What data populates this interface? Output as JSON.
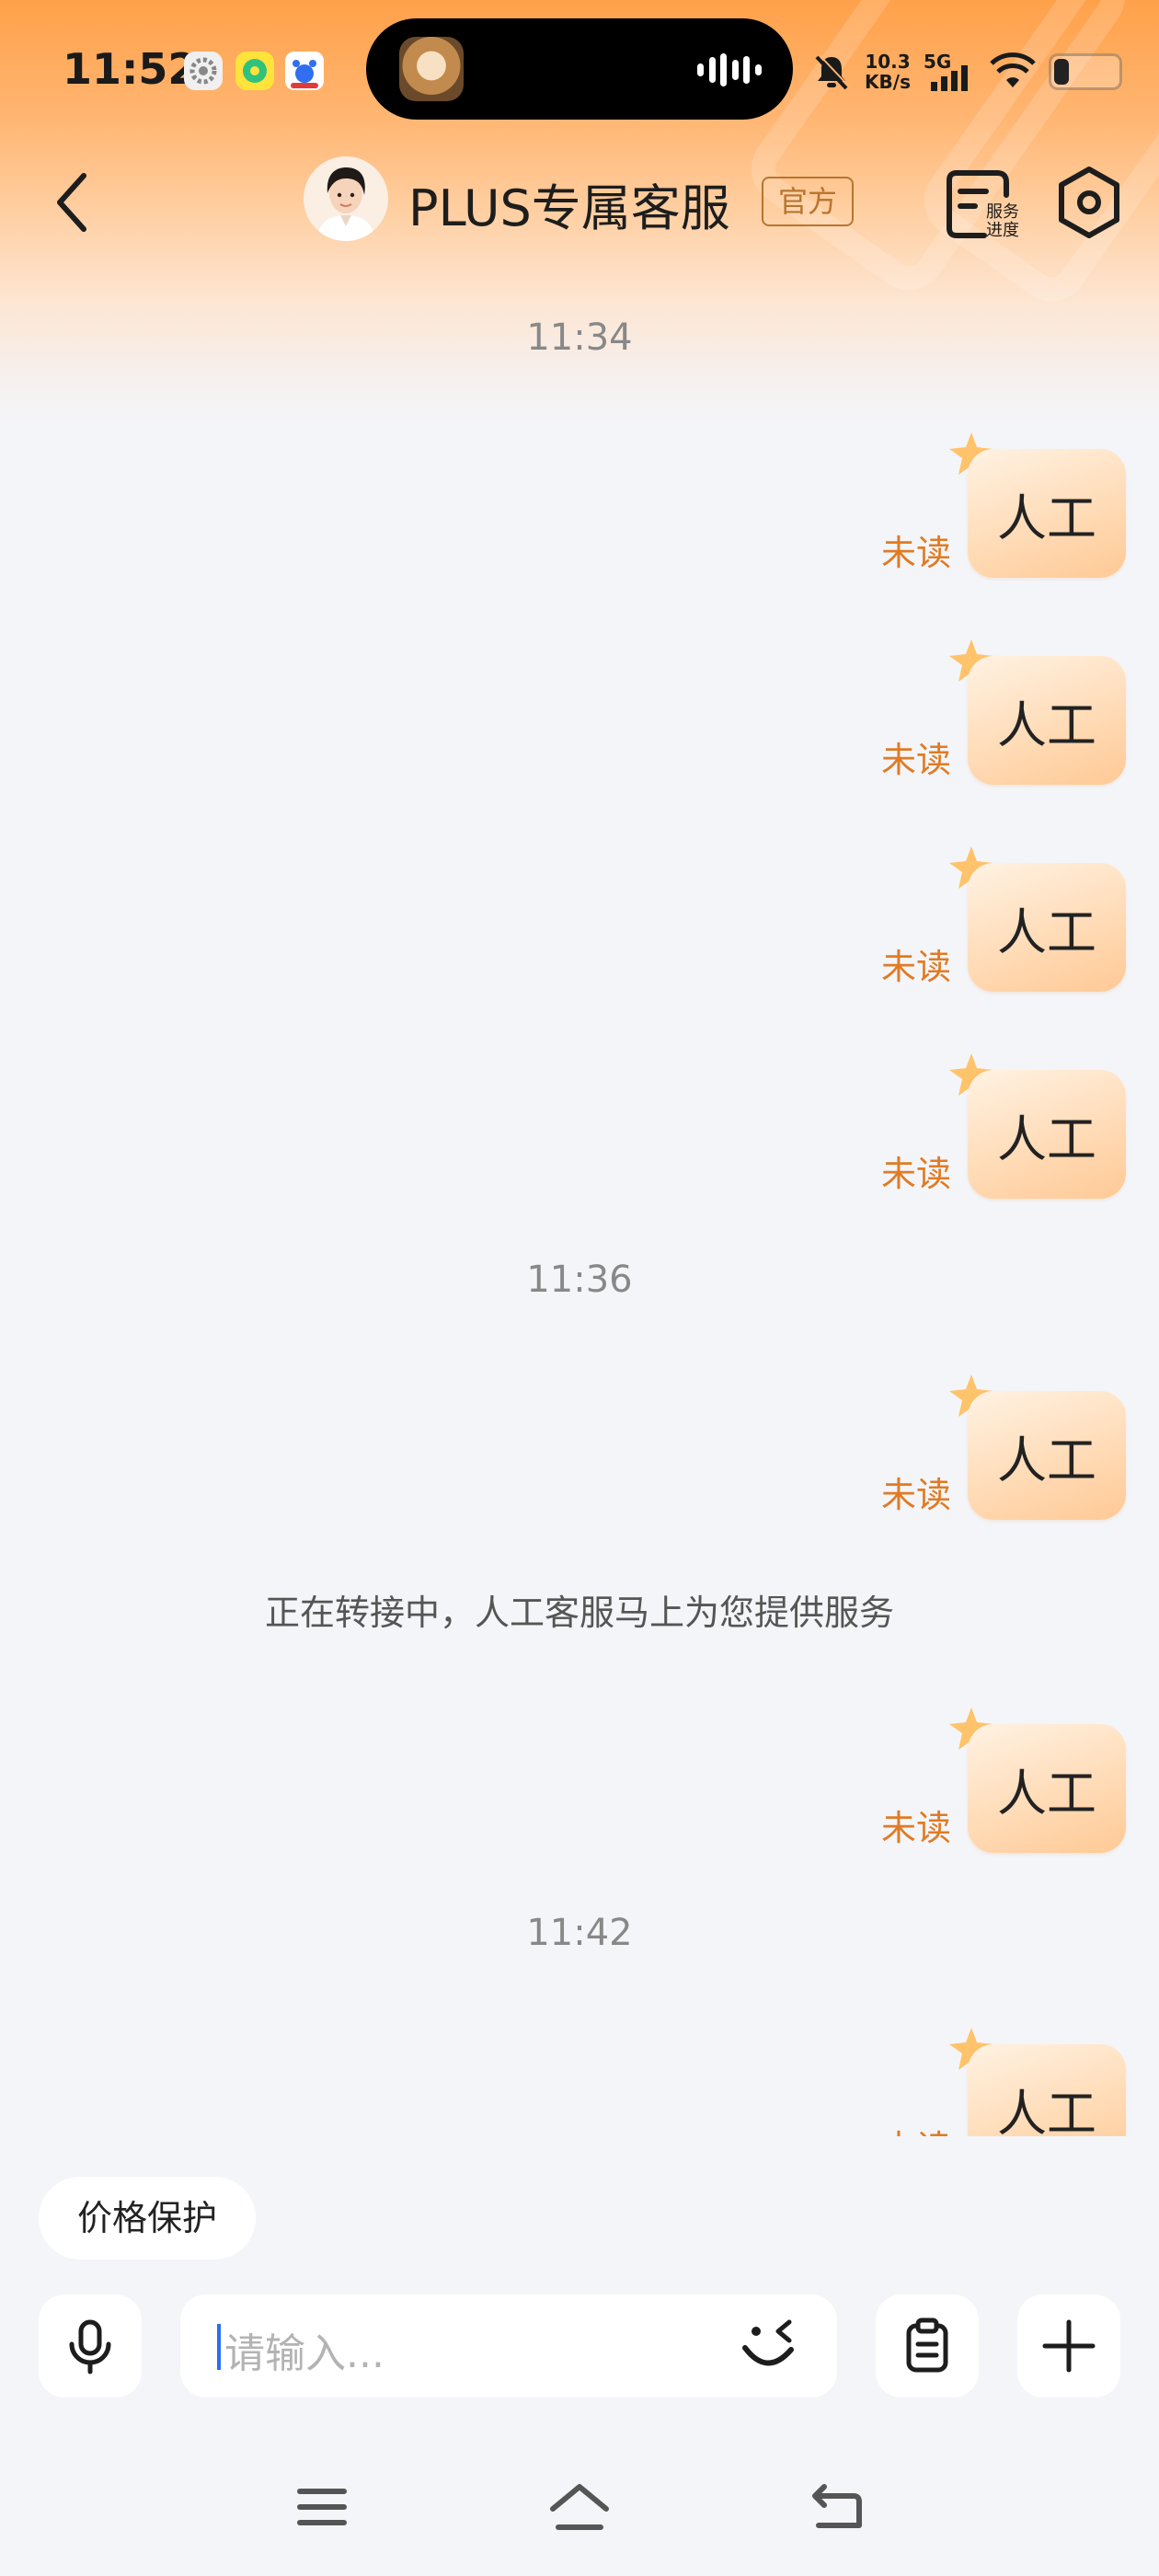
{
  "status_bar": {
    "time": "11:52",
    "net_speed_value": "10.3",
    "net_speed_unit": "KB/s",
    "network": "5G"
  },
  "header": {
    "title": "PLUS专属客服",
    "badge": "官方",
    "progress_label_line1": "服务",
    "progress_label_line2": "进度"
  },
  "messages": {
    "time_1": "11:34",
    "time_2": "11:36",
    "time_3": "11:42",
    "bubble_text": "人工",
    "unread_label": "未读",
    "system_note": "正在转接中，人工客服马上为您提供服务"
  },
  "quick_reply": {
    "chip": "价格保护"
  },
  "composer": {
    "placeholder": "请输入..."
  },
  "colors": {
    "accent_orange": "#e07b24",
    "bubble_from": "#fff2e3",
    "bubble_to": "#ffc995",
    "badge_brown": "#b8752f"
  }
}
